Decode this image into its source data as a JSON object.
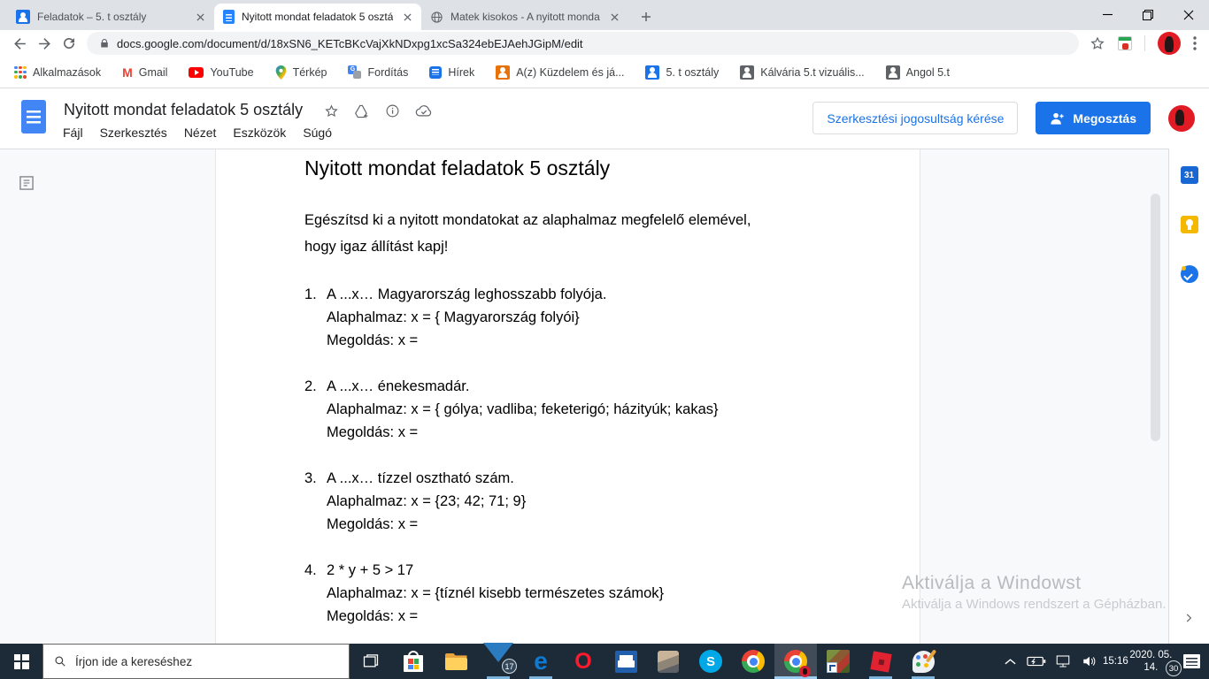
{
  "browser": {
    "tabs": [
      {
        "title": "Feladatok – 5. t osztály"
      },
      {
        "title": "Nyitott mondat feladatok 5 osztá"
      },
      {
        "title": "Matek kisokos - A nyitott monda"
      }
    ],
    "url": "docs.google.com/document/d/18xSN6_KETcBKcVajXkNDxpg1xcSa324ebEJAehJGipM/edit",
    "bookmarks": [
      "Alkalmazások",
      "Gmail",
      "YouTube",
      "Térkép",
      "Fordítás",
      "Hírek",
      "A(z) Küzdelem és já...",
      "5. t osztály",
      "Kálvária 5.t vizuális...",
      "Angol 5.t"
    ]
  },
  "docs_header": {
    "title": "Nyitott mondat feladatok 5 osztály",
    "menu": [
      "Fájl",
      "Szerkesztés",
      "Nézet",
      "Eszközök",
      "Súgó"
    ],
    "request_edit_label": "Szerkesztési jogosultság kérése",
    "share_label": "Megosztás"
  },
  "document": {
    "heading": "Nyitott mondat feladatok 5 osztály",
    "intro_line1": "Egészítsd ki a nyitott mondatokat az alaphalmaz megfelelő elemével,",
    "intro_line2": "hogy igaz állítást kapj!",
    "items": [
      {
        "num": "1.",
        "line1": "A ...x… Magyarország leghosszabb folyója.",
        "line2": "Alaphalmaz: x = { Magyarország folyói}",
        "line3": "Megoldás: x ="
      },
      {
        "num": "2.",
        "line1": "A ...x… énekesmadár.",
        "line2": "Alaphalmaz: x = { gólya; vadliba; feketerigó; házityúk; kakas}",
        "line3": "Megoldás: x ="
      },
      {
        "num": "3.",
        "line1": "A ...x… tízzel osztható szám.",
        "line2": "Alaphalmaz: x = {23; 42; 71; 9}",
        "line3": "Megoldás: x ="
      },
      {
        "num": "4.",
        "line1": "2 * y + 5 > 17",
        "line2": "Alaphalmaz: x = {tíznél kisebb természetes számok}",
        "line3": "Megoldás: x ="
      }
    ]
  },
  "watermark": {
    "line1": "Aktiválja a Windowst",
    "line2": "Aktiválja a Windows rendszert a Gépházban."
  },
  "taskbar": {
    "search_placeholder": "Írjon ide a kereséshez",
    "mail_badge": "17",
    "notification_badge": "30",
    "time": "15:16",
    "date": "2020. 05. 14."
  },
  "glyphs": {
    "gmail": "M",
    "edge": "e",
    "opera": "O",
    "skype": "S",
    "calendar": "31"
  },
  "colors": {
    "accent": "#1a73e8",
    "share_button": "#1a73e8",
    "taskbar": "#1d2a38",
    "active_tab": "#ffffff",
    "tab_strip": "#dee1e6"
  }
}
